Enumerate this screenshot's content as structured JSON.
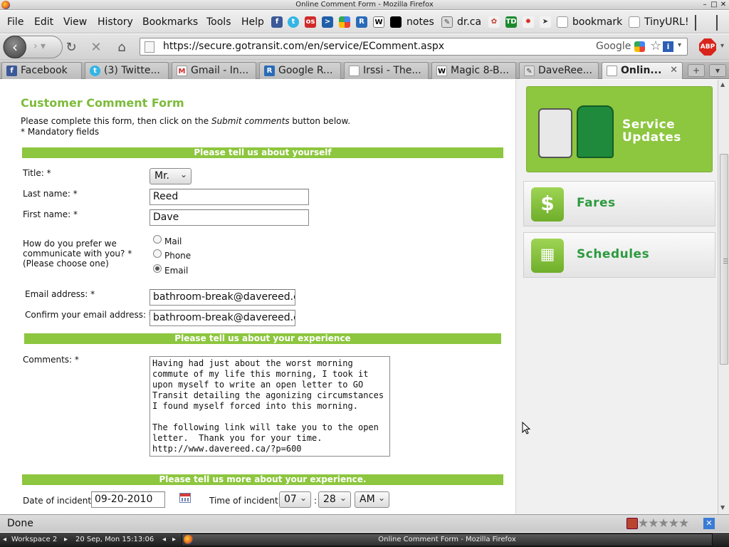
{
  "window": {
    "title": "Online Comment Form - Mozilla Firefox"
  },
  "menus": [
    "File",
    "Edit",
    "View",
    "History",
    "Bookmarks",
    "Tools",
    "Help"
  ],
  "bookmarks": {
    "notes": "notes",
    "dr": "dr.ca",
    "bookmark": "bookmark",
    "tinyurl": "TinyURL!"
  },
  "nav": {
    "url": "https://secure.gotransit.com/en/service/EComment.aspx",
    "search_engine": "Google",
    "adblock": "ABP"
  },
  "tabs": [
    "Facebook",
    "(3) Twitte...",
    "Gmail - In...",
    "Google R...",
    "Irssi - The...",
    "Magic 8-B...",
    "DaveRee...",
    "Onlin..."
  ],
  "form": {
    "title": "Customer Comment Form",
    "intro_prefix": "Please complete this form, then click on the ",
    "intro_em": "Submit comments",
    "intro_suffix": " button below.",
    "mandatory": "* Mandatory fields",
    "section1": "Please tell us about yourself",
    "title_label": "Title: *",
    "title_value": "Mr.",
    "lastname_label": "Last name: *",
    "lastname_value": "Reed",
    "firstname_label": "First name: *",
    "firstname_value": "Dave",
    "comm_label_1": "How do you prefer we",
    "comm_label_2": "communicate with you? *",
    "comm_label_3": "(Please choose one)",
    "comm_options": [
      "Mail",
      "Phone",
      "Email"
    ],
    "comm_selected": "Email",
    "email_label": "Email address: *",
    "email_value": "bathroom-break@davereed.ca",
    "confirm_label": "Confirm your email address: *",
    "confirm_value": "bathroom-break@davereed.ca",
    "section2": "Please tell us about your experience",
    "comments_label": "Comments: *",
    "comments_value": "Having had just about the worst morning\ncommute of my life this morning, I took it\nupon myself to write an open letter to GO\nTransit detailing the agonizing circumstances\nI found myself forced into this morning.\n\nThe following link will take you to the open\nletter.  Thank you for your time.\nhttp://www.davereed.ca/?p=600",
    "section3": "Please tell us more about your experience.",
    "date_label": "Date of incident:",
    "date_value": "09-20-2010",
    "time_label": "Time of incident:",
    "time_hour": "07",
    "time_sep": ":",
    "time_min": "28",
    "time_ampm": "AM"
  },
  "sidebar": {
    "service_updates_1": "Service",
    "service_updates_2": "Updates",
    "fares": "Fares",
    "fares_symbol": "$",
    "schedules": "Schedules"
  },
  "status": {
    "text": "Done"
  },
  "taskbar": {
    "workspace": "Workspace 2",
    "datetime": "20 Sep, Mon 15:13:06",
    "window": "Online Comment Form - Mozilla Firefox"
  }
}
